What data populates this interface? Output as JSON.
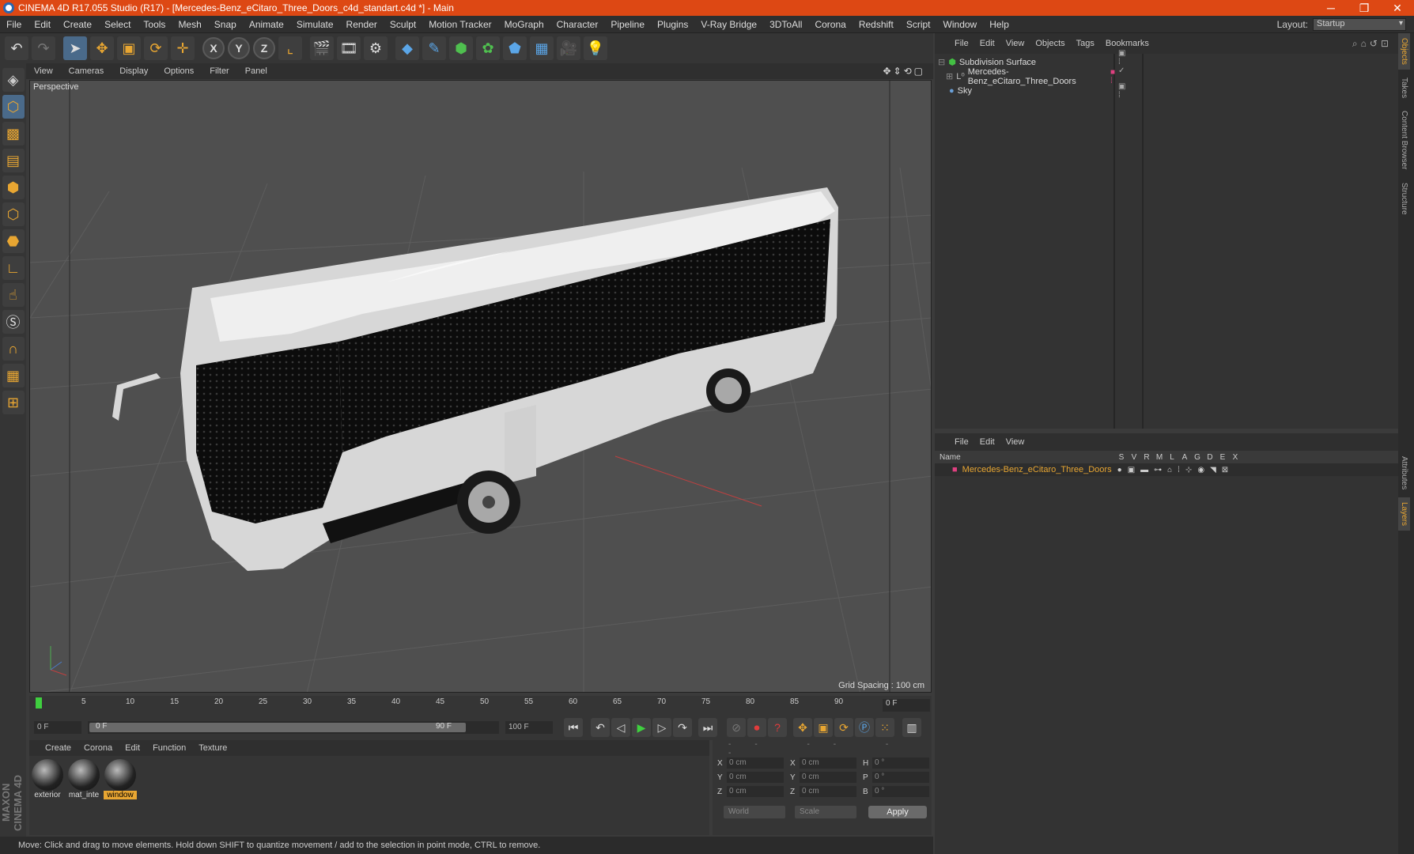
{
  "window": {
    "title": "CINEMA 4D R17.055 Studio (R17) - [Mercedes-Benz_eCitaro_Three_Doors_c4d_standart.c4d *] - Main"
  },
  "menubar": {
    "items": [
      "File",
      "Edit",
      "Create",
      "Select",
      "Tools",
      "Mesh",
      "Snap",
      "Animate",
      "Simulate",
      "Render",
      "Sculpt",
      "Motion Tracker",
      "MoGraph",
      "Character",
      "Pipeline",
      "Plugins",
      "V-Ray Bridge",
      "3DToAll",
      "Corona",
      "Redshift",
      "Script",
      "Window",
      "Help"
    ],
    "layout_label": "Layout:",
    "layout_value": "Startup"
  },
  "viewport": {
    "menu": [
      "View",
      "Cameras",
      "Display",
      "Options",
      "Filter",
      "Panel"
    ],
    "label": "Perspective",
    "grid_spacing": "Grid Spacing : 100 cm"
  },
  "timeline": {
    "ticks": [
      "0",
      "5",
      "10",
      "15",
      "20",
      "25",
      "30",
      "35",
      "40",
      "45",
      "50",
      "55",
      "60",
      "65",
      "70",
      "75",
      "80",
      "85",
      "90"
    ],
    "current": "0 F"
  },
  "transport": {
    "start": "0 F",
    "range_start": "0 F",
    "range_end": "90 F",
    "end": "100 F"
  },
  "materials": {
    "menu": [
      "Create",
      "Corona",
      "Edit",
      "Function",
      "Texture"
    ],
    "items": [
      {
        "label": "exterior",
        "selected": false
      },
      {
        "label": "mat_inte",
        "selected": false
      },
      {
        "label": "window",
        "selected": true
      }
    ]
  },
  "coords": {
    "header": "--  --  --",
    "rows": [
      {
        "a": "X",
        "av": "0 cm",
        "b": "X",
        "bv": "0 cm",
        "c": "H",
        "cv": "0 °"
      },
      {
        "a": "Y",
        "av": "0 cm",
        "b": "Y",
        "bv": "0 cm",
        "c": "P",
        "cv": "0 °"
      },
      {
        "a": "Z",
        "av": "0 cm",
        "b": "Z",
        "bv": "0 cm",
        "c": "B",
        "cv": "0 °"
      }
    ],
    "world": "World",
    "scale": "Scale",
    "apply": "Apply"
  },
  "status": "Move: Click and drag to move elements. Hold down SHIFT to quantize movement / add to the selection in point mode, CTRL to remove.",
  "objects": {
    "menu": [
      "File",
      "Edit",
      "View",
      "Objects",
      "Tags",
      "Bookmarks"
    ],
    "items": [
      {
        "name": "Subdivision Surface",
        "color": "#43c043"
      },
      {
        "name": "Mercedes-Benz_eCitaro_Three_Doors",
        "color": "#bbbbbb"
      },
      {
        "name": "Sky",
        "color": "#6aa0d8"
      }
    ]
  },
  "layers": {
    "menu": [
      "File",
      "Edit",
      "View"
    ],
    "columns": [
      "Name",
      "S",
      "V",
      "R",
      "M",
      "L",
      "A",
      "G",
      "D",
      "E",
      "X"
    ],
    "row": "Mercedes-Benz_eCitaro_Three_Doors",
    "row_color": "#e04080"
  },
  "right_tabs": [
    "Objects",
    "Takes",
    "Content Browser",
    "Structure",
    "Attributes",
    "Layers"
  ],
  "colors": {
    "title_bar": "#dd4814",
    "accent": "#e8a632"
  }
}
